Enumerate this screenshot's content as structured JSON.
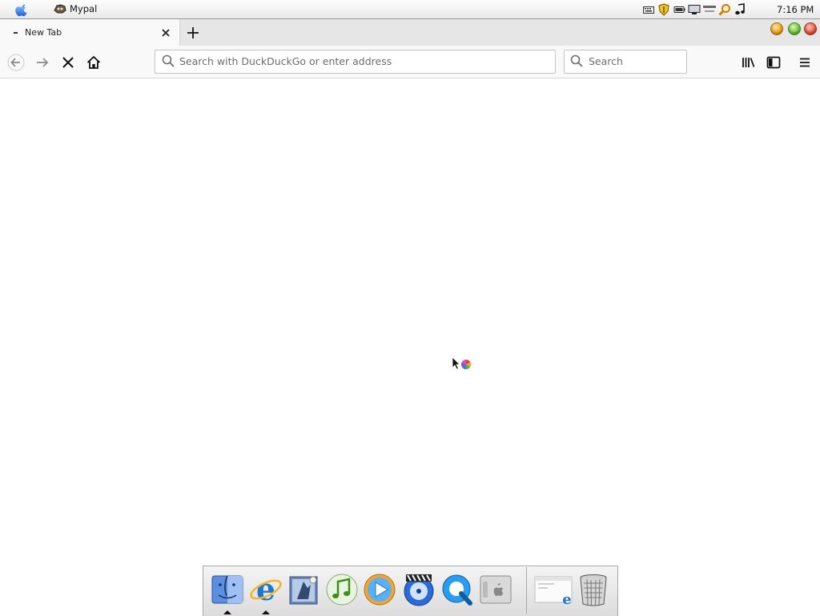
{
  "menubar": {
    "app_name": "Mypal",
    "clock": "7:16 PM",
    "tray_icons": [
      "keyboard-icon",
      "shield-icon",
      "battery-icon",
      "display-icon",
      "network-icon",
      "search-icon",
      "audio-icon"
    ]
  },
  "tab": {
    "title": "New Tab",
    "close_icon": "close-icon",
    "new_tab_icon": "plus-icon"
  },
  "window_controls": {
    "minimize_color": "#e89a0c",
    "zoom_color": "#5fbd2c",
    "close_color": "#e2452c"
  },
  "toolbar": {
    "url_placeholder": "Search with DuckDuckGo or enter address",
    "search_placeholder": "Search",
    "buttons": [
      "back-icon",
      "forward-icon",
      "stop-icon",
      "home-icon",
      "library-icon",
      "sidebar-icon",
      "hamburger-menu-icon"
    ]
  },
  "dock": {
    "items": [
      "finder-icon",
      "internet-explorer-icon",
      "mail-icon",
      "itunes-icon",
      "quicktime-player-icon",
      "dvd-player-icon",
      "quicktime-icon",
      "system-preferences-icon",
      "minimized-window-icon",
      "trash-icon"
    ],
    "running": [
      "finder-icon",
      "internet-explorer-icon"
    ]
  }
}
